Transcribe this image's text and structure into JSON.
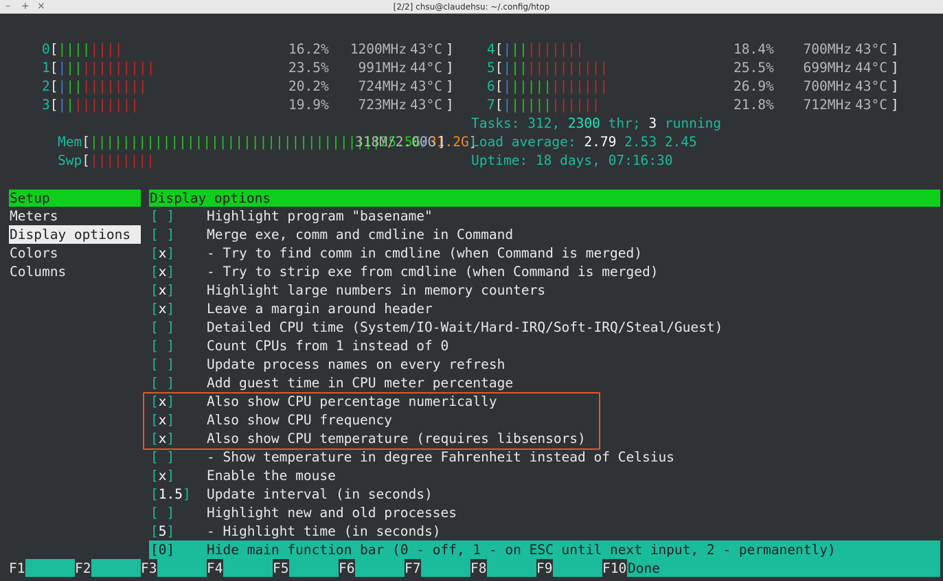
{
  "window": {
    "title": "[2/2] chsu@claudehsu: ~/.config/htop",
    "controls": [
      "–",
      "+",
      "×"
    ]
  },
  "cpus": [
    {
      "id": "0",
      "bar": [
        {
          "c": "green",
          "t": "||||"
        },
        {
          "c": "red",
          "t": "||||"
        }
      ],
      "pct": "16.2%",
      "freq": "1200MHz",
      "temp": "43°C"
    },
    {
      "id": "1",
      "bar": [
        {
          "c": "blue",
          "t": "|"
        },
        {
          "c": "green",
          "t": "||"
        },
        {
          "c": "red",
          "t": "|||||||||"
        }
      ],
      "pct": "23.5%",
      "freq": "991MHz",
      "temp": "44°C"
    },
    {
      "id": "2",
      "bar": [
        {
          "c": "blue",
          "t": "|"
        },
        {
          "c": "green",
          "t": "||"
        },
        {
          "c": "red",
          "t": "||||||||"
        }
      ],
      "pct": "20.2%",
      "freq": "724MHz",
      "temp": "43°C"
    },
    {
      "id": "3",
      "bar": [
        {
          "c": "blue",
          "t": "|"
        },
        {
          "c": "green",
          "t": "|"
        },
        {
          "c": "red",
          "t": "||||||||"
        }
      ],
      "pct": "19.9%",
      "freq": "723MHz",
      "temp": "43°C"
    },
    {
      "id": "4",
      "bar": [
        {
          "c": "blue",
          "t": "|"
        },
        {
          "c": "green",
          "t": "||"
        },
        {
          "c": "red",
          "t": "|||||||"
        }
      ],
      "pct": "18.4%",
      "freq": "700MHz",
      "temp": "43°C"
    },
    {
      "id": "5",
      "bar": [
        {
          "c": "blue",
          "t": "|"
        },
        {
          "c": "green",
          "t": "||"
        },
        {
          "c": "red",
          "t": "||||||||||"
        }
      ],
      "pct": "25.5%",
      "freq": "699MHz",
      "temp": "44°C"
    },
    {
      "id": "6",
      "bar": [
        {
          "c": "blue",
          "t": "|"
        },
        {
          "c": "green",
          "t": "|||||"
        },
        {
          "c": "red",
          "t": "|||||||"
        }
      ],
      "pct": "26.9%",
      "freq": "700MHz",
      "temp": "43°C"
    },
    {
      "id": "7",
      "bar": [
        {
          "c": "blue",
          "t": "|"
        },
        {
          "c": "green",
          "t": "|||||"
        },
        {
          "c": "red",
          "t": "||||||"
        }
      ],
      "pct": "21.8%",
      "freq": "712MHz",
      "temp": "43°C"
    }
  ],
  "mem": {
    "label": "Mem",
    "bar": "||||||||||||||||||||||||||||||||||||",
    "used": "25.5G",
    "total": "31.2G"
  },
  "swp": {
    "label": "Swp",
    "bar": "||||||||",
    "value": "318M/2.00G"
  },
  "tasks": {
    "label": "Tasks:",
    "count": "312",
    "threads": "2300",
    "thr_label": "thr;",
    "running": "3",
    "running_label": "running"
  },
  "load": {
    "label": "Load average:",
    "one": "2.79",
    "five": "2.53",
    "fifteen": "2.45"
  },
  "uptime": {
    "label": "Uptime:",
    "value": "18 days, 07:16:30"
  },
  "setup": {
    "header": "Setup",
    "categories": [
      "Meters",
      "Display options",
      "Colors",
      "Columns"
    ],
    "selected": "Display options"
  },
  "display_options": {
    "header": "Display options",
    "options": [
      {
        "state": " ",
        "label": "Highlight program \"basename\""
      },
      {
        "state": " ",
        "label": "Merge exe, comm and cmdline in Command"
      },
      {
        "state": "x",
        "label": "- Try to find comm in cmdline (when Command is merged)"
      },
      {
        "state": "x",
        "label": "- Try to strip exe from cmdline (when Command is merged)"
      },
      {
        "state": "x",
        "label": "Highlight large numbers in memory counters"
      },
      {
        "state": "x",
        "label": "Leave a margin around header"
      },
      {
        "state": " ",
        "label": "Detailed CPU time (System/IO-Wait/Hard-IRQ/Soft-IRQ/Steal/Guest)"
      },
      {
        "state": " ",
        "label": "Count CPUs from 1 instead of 0"
      },
      {
        "state": " ",
        "label": "Update process names on every refresh"
      },
      {
        "state": " ",
        "label": "Add guest time in CPU meter percentage"
      },
      {
        "state": "x",
        "label": "Also show CPU percentage numerically"
      },
      {
        "state": "x",
        "label": "Also show CPU frequency"
      },
      {
        "state": "x",
        "label": "Also show CPU temperature (requires libsensors)"
      },
      {
        "state": " ",
        "label": "- Show temperature in degree Fahrenheit instead of Celsius"
      },
      {
        "state": "x",
        "label": "Enable the mouse"
      },
      {
        "state": "1.5",
        "label": "Update interval (in seconds)"
      },
      {
        "state": " ",
        "label": "Highlight new and old processes"
      },
      {
        "state": "5",
        "label": "- Highlight time (in seconds)"
      },
      {
        "state": "0",
        "label": "Hide main function bar (0 - off, 1 - on ESC until next input, 2 - permanently)"
      }
    ],
    "selected_index": 18
  },
  "function_bar": [
    {
      "key": "F1",
      "label": ""
    },
    {
      "key": "F2",
      "label": ""
    },
    {
      "key": "F3",
      "label": ""
    },
    {
      "key": "F4",
      "label": ""
    },
    {
      "key": "F5",
      "label": ""
    },
    {
      "key": "F6",
      "label": ""
    },
    {
      "key": "F7",
      "label": ""
    },
    {
      "key": "F8",
      "label": ""
    },
    {
      "key": "F9",
      "label": ""
    },
    {
      "key": "F10",
      "label": "Done"
    }
  ],
  "colors": {
    "background": "#2f3336",
    "accent_cyan": "#1abc9c",
    "header_green": "#0ecf1c",
    "meter_red": "#d42020",
    "meter_blue": "#3584e4",
    "annotation_orange": "#e8571f"
  }
}
